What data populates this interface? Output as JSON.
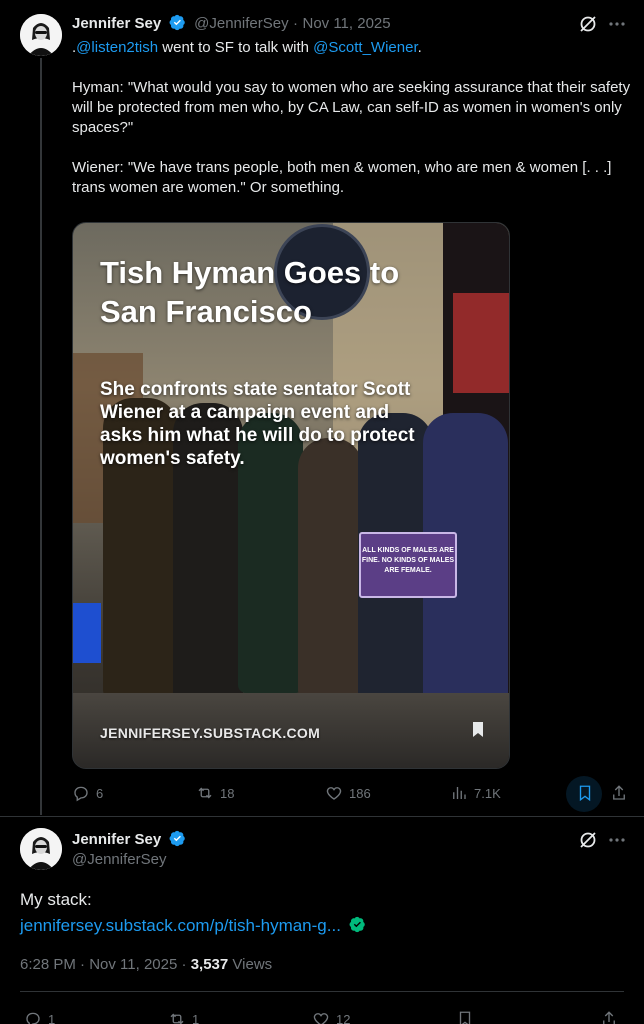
{
  "tweet1": {
    "name": "Jennifer Sey",
    "handle": "@JenniferSey",
    "date": "Nov 11, 2025",
    "separator": "·",
    "text_prefix": ".",
    "mention1": "@listen2tish",
    "text_mid": " went to SF to talk with ",
    "mention2": "@Scott_Wiener",
    "text_end": ".",
    "para2": "Hyman: \"What would you say to women who are seeking assurance that their safety will be protected from men who, by CA Law, can self-ID as women in women's only spaces?\"",
    "para3": "Wiener: \"We have trans people, both men & women, who are men & women [. . .] trans women are women.\" Or something.",
    "media": {
      "title": "Tish Hyman Goes to San Francisco",
      "subtitle": "She confronts state sentator Scott Wiener at a campaign event and asks him what he will do to protect women's safety.",
      "watermark": "JENNIFERSEY.SUBSTACK.COM",
      "sign_text": "ALL KINDS OF MALES ARE FINE. NO KINDS OF MALES ARE FEMALE."
    },
    "actions": {
      "replies": "6",
      "reposts": "18",
      "likes": "186",
      "views": "7.1K"
    }
  },
  "tweet2": {
    "name": "Jennifer Sey",
    "handle": "@JenniferSey",
    "body": "My stack:",
    "link": "jennifersey.substack.com/p/tish-hyman-g...",
    "time": "6:28 PM",
    "separator": "·",
    "date": "Nov 11, 2025",
    "views_count": "3,537",
    "views_label": "Views",
    "actions": {
      "replies": "1",
      "reposts": "1",
      "likes": "12"
    }
  },
  "colors": {
    "background": "#000000",
    "text": "#e7e9ea",
    "muted": "#71767b",
    "accent": "#1d9bf0",
    "verified": "#1d9bf0"
  }
}
